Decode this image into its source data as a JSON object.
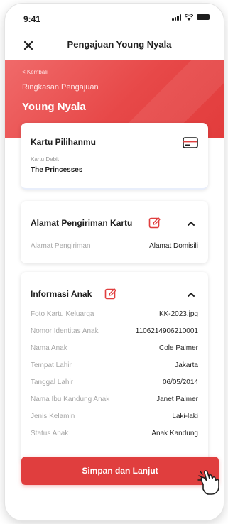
{
  "status_bar": {
    "time": "9:41",
    "signal_icon": "signal-icon",
    "wifi_icon": "wifi-icon",
    "battery_icon": "battery-icon"
  },
  "header": {
    "title": "Pengajuan Young Nyala",
    "close_icon": "close-icon"
  },
  "hero": {
    "back_label": "< Kembali",
    "subtitle": "Ringkasan Pengajuan",
    "title": "Young Nyala"
  },
  "card_section": {
    "title": "Kartu Pilihanmu",
    "icon": "credit-card-icon",
    "label": "Kartu Debit",
    "value": "The Princesses"
  },
  "shipping_section": {
    "title": "Alamat Pengiriman Kartu",
    "edit_icon": "edit-icon",
    "toggle_icon": "chevron-up-icon",
    "rows": [
      {
        "label": "Alamat Pengiriman",
        "value": "Alamat Domisili"
      }
    ]
  },
  "child_section": {
    "title": "Informasi Anak",
    "edit_icon": "edit-icon",
    "toggle_icon": "chevron-up-icon",
    "rows": [
      {
        "label": "Foto Kartu Keluarga",
        "value": "KK-2023.jpg"
      },
      {
        "label": "Nomor Identitas Anak",
        "value": "1106214906210001"
      },
      {
        "label": "Nama Anak",
        "value": "Cole Palmer"
      },
      {
        "label": "Tempat Lahir",
        "value": "Jakarta"
      },
      {
        "label": "Tanggal Lahir",
        "value": "06/05/2014"
      },
      {
        "label": "Nama Ibu Kandung Anak",
        "value": "Janet Palmer"
      },
      {
        "label": "Jenis Kelamin",
        "value": "Laki-laki"
      },
      {
        "label": "Status Anak",
        "value": "Anak Kandung"
      }
    ]
  },
  "footer": {
    "primary_button_label": "Simpan dan Lanjut",
    "pointer_icon": "hand-pointer-icon"
  },
  "colors": {
    "brand_red": "#e03e3e",
    "hero_red": "#e74848",
    "edit_icon_red": "#e03e3e"
  }
}
